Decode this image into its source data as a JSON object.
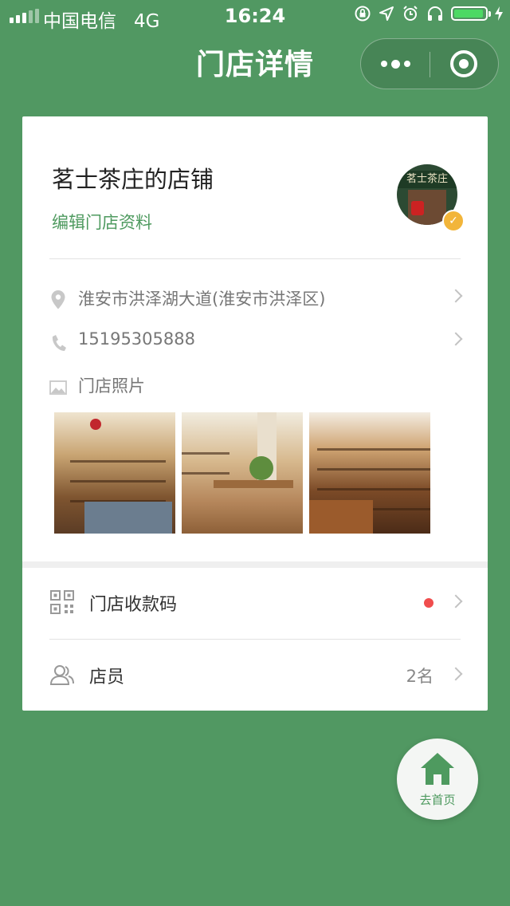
{
  "status_bar": {
    "carrier": "中国电信",
    "network": "4G",
    "time": "16:24",
    "battery_level": 0.95,
    "icons": [
      "screen-lock-icon",
      "location-arrow-icon",
      "alarm-icon",
      "headphones-icon",
      "battery-icon",
      "charging-bolt-icon"
    ]
  },
  "nav": {
    "title": "门店详情",
    "more_icon": "more-dots-icon",
    "close_icon": "target-close-icon"
  },
  "store": {
    "name": "茗士茶庄的店铺",
    "edit_label": "编辑门店资料",
    "avatar_sign": "茗士茶庄",
    "verified_icon": "verified-check-icon"
  },
  "info": {
    "address": "淮安市洪泽湖大道(淮安市洪泽区)",
    "phone": "15195305888",
    "photos_label": "门店照片",
    "photos": [
      "store-photo-1",
      "store-photo-2",
      "store-photo-3"
    ]
  },
  "menu": {
    "payment_code_label": "门店收款码",
    "staff_label": "店员",
    "staff_count": "2名"
  },
  "home_button": {
    "label": "去首页"
  },
  "colors": {
    "background": "#519862",
    "accent": "#4e9a5f",
    "badge_red": "#f04d4d",
    "verified": "#f2b53a"
  }
}
